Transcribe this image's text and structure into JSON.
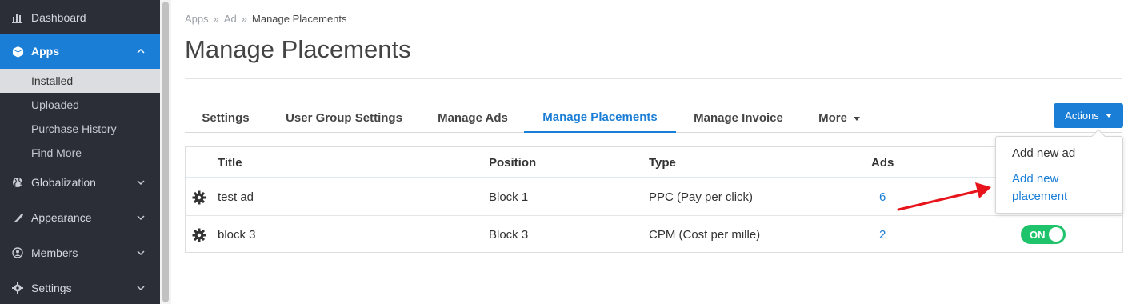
{
  "sidebar": {
    "items": [
      {
        "label": "Dashboard",
        "icon": "chart-bars-icon"
      },
      {
        "label": "Apps",
        "icon": "cube-icon"
      },
      {
        "label": "Globalization",
        "icon": "globe-icon"
      },
      {
        "label": "Appearance",
        "icon": "paint-icon"
      },
      {
        "label": "Members",
        "icon": "user-icon"
      },
      {
        "label": "Settings",
        "icon": "gear-icon"
      }
    ],
    "sub_items": [
      "Installed",
      "Uploaded",
      "Purchase History",
      "Find More"
    ]
  },
  "breadcrumb": {
    "items": [
      "Apps",
      "Ad",
      "Manage Placements"
    ]
  },
  "page_title": "Manage Placements",
  "tabs": [
    "Settings",
    "User Group Settings",
    "Manage Ads",
    "Manage Placements",
    "Manage Invoice",
    "More"
  ],
  "actions": {
    "label": "Actions",
    "menu": [
      "Add new ad",
      "Add new placement"
    ]
  },
  "table": {
    "headers": [
      "Title",
      "Position",
      "Type",
      "Ads"
    ],
    "rows": [
      {
        "title": "test ad",
        "position": "Block 1",
        "type": "PPC (Pay per click)",
        "ads": "6"
      },
      {
        "title": "block 3",
        "position": "Block 3",
        "type": "CPM (Cost per mille)",
        "ads": "2",
        "toggle": "ON"
      }
    ]
  },
  "colors": {
    "accent": "#1a7ed6",
    "sidebar_bg": "#2b2e37",
    "toggle_on": "#1fc36b",
    "annotation": "#e8141b"
  }
}
